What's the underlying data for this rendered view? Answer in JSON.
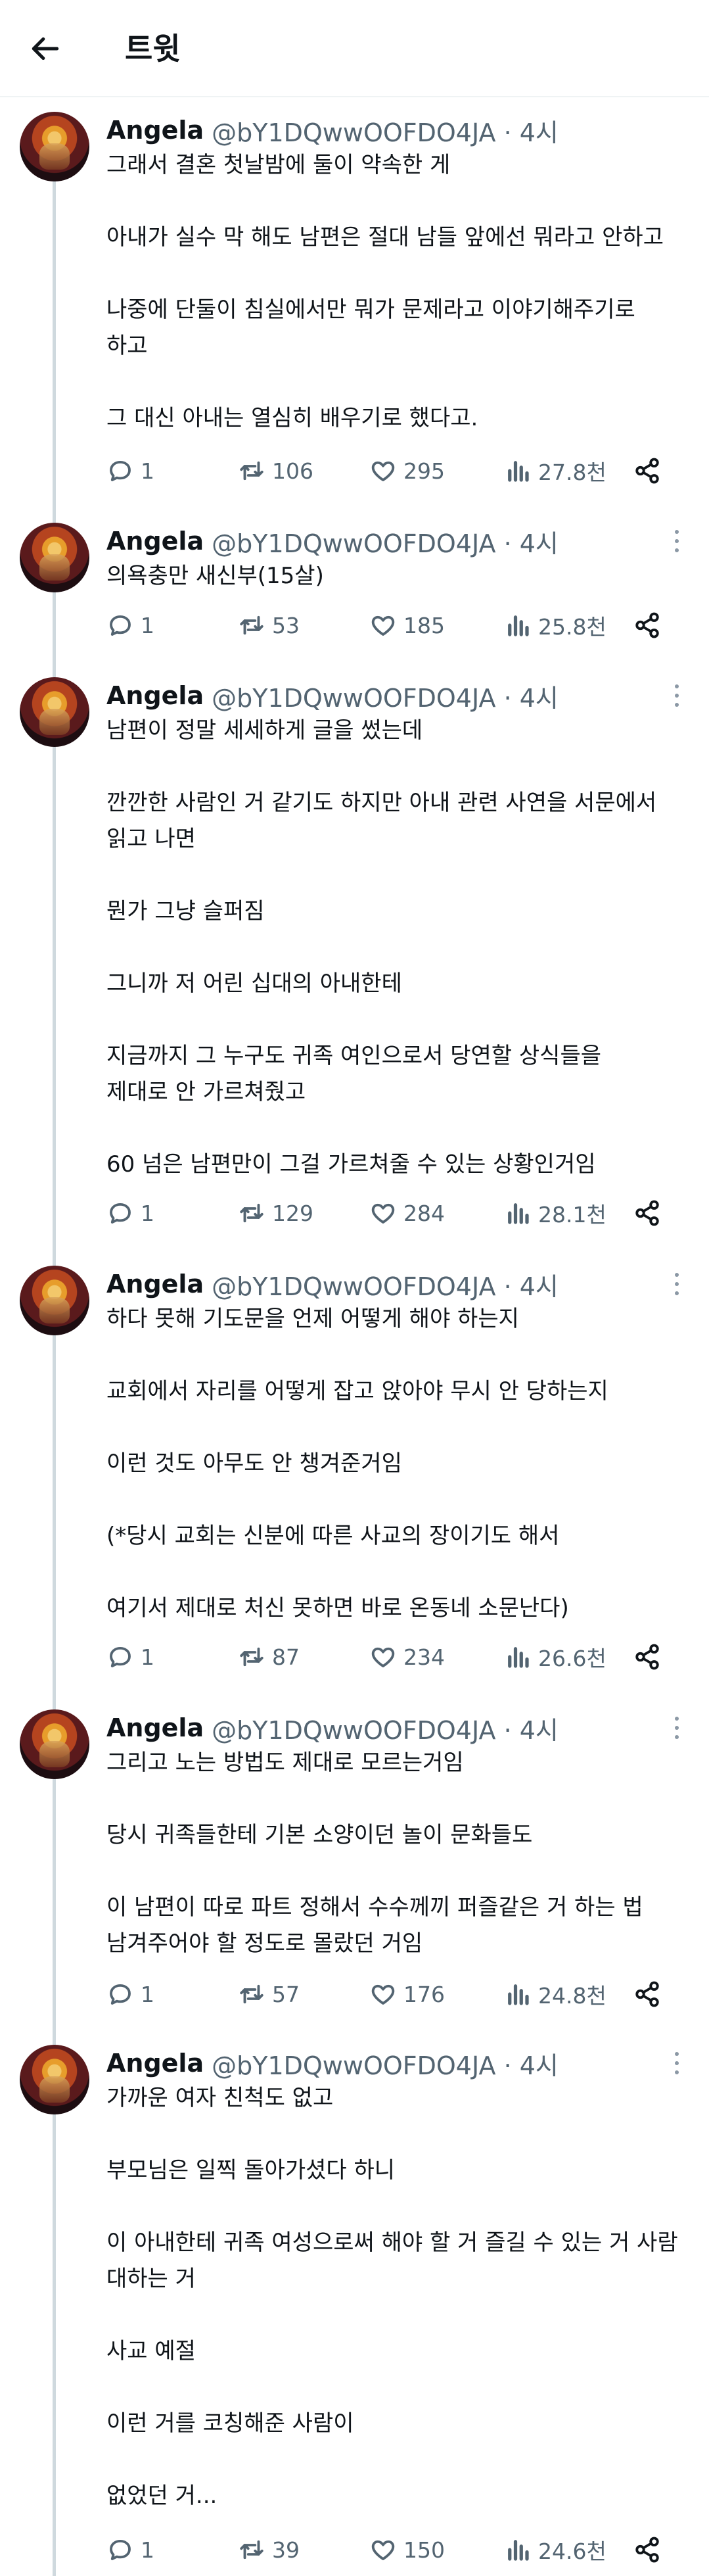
{
  "header": {
    "title": "트윗"
  },
  "tweets": [
    {
      "name": "Angela",
      "handle": "@bY1DQwwOOFDO4JA · 4시",
      "paragraphs": [
        "그래서 결혼 첫날밤에 둘이 약속한 게",
        "아내가 실수 막 해도 남편은 절대 남들 앞에선 뭐라고 안하고",
        "나중에 단둘이 침실에서만 뭐가 문제라고 이야기해주기로\n하고",
        "그 대신 아내는 열심히 배우기로 했다고."
      ],
      "replies": "1",
      "retweets": "106",
      "likes": "295",
      "views": "27.8천"
    },
    {
      "name": "Angela",
      "handle": "@bY1DQwwOOFDO4JA · 4시",
      "paragraphs": [
        "의욕충만 새신부(15살)"
      ],
      "replies": "1",
      "retweets": "53",
      "likes": "185",
      "views": "25.8천"
    },
    {
      "name": "Angela",
      "handle": "@bY1DQwwOOFDO4JA · 4시",
      "paragraphs": [
        "남편이 정말 세세하게 글을 썼는데",
        "깐깐한 사람인 거 같기도 하지만 아내 관련 사연을 서문에서\n읽고 나면",
        "뭔가 그냥 슬퍼짐",
        "그니까 저 어린 십대의 아내한테",
        "지금까지 그 누구도 귀족 여인으로서 당연할 상식들을\n제대로 안 가르쳐줬고",
        "60 넘은 남편만이 그걸 가르쳐줄 수 있는 상황인거임"
      ],
      "replies": "1",
      "retweets": "129",
      "likes": "284",
      "views": "28.1천"
    },
    {
      "name": "Angela",
      "handle": "@bY1DQwwOOFDO4JA · 4시",
      "paragraphs": [
        "하다 못해 기도문을 언제 어떻게 해야 하는지",
        "교회에서 자리를 어떻게 잡고 앉아야 무시 안 당하는지",
        "이런 것도 아무도 안 챙겨준거임",
        "(*당시 교회는 신분에 따른 사교의 장이기도 해서",
        "여기서 제대로 처신 못하면 바로 온동네 소문난다)"
      ],
      "replies": "1",
      "retweets": "87",
      "likes": "234",
      "views": "26.6천"
    },
    {
      "name": "Angela",
      "handle": "@bY1DQwwOOFDO4JA · 4시",
      "paragraphs": [
        "그리고 노는 방법도 제대로 모르는거임",
        "당시 귀족들한테 기본 소양이던 놀이 문화들도",
        "이 남편이 따로 파트 정해서 수수께끼 퍼즐같은 거 하는 법\n남겨주어야 할 정도로 몰랐던 거임"
      ],
      "replies": "1",
      "retweets": "57",
      "likes": "176",
      "views": "24.8천"
    },
    {
      "name": "Angela",
      "handle": "@bY1DQwwOOFDO4JA · 4시",
      "paragraphs": [
        "가까운 여자 친척도 없고",
        "부모님은 일찍 돌아가셨다 하니",
        "이 아내한테 귀족 여성으로써 해야 할 거 즐길 수 있는 거 사람\n대하는 거",
        "사교 예절",
        "이런 거를 코칭해준 사람이",
        "없었던 거..."
      ],
      "replies": "1",
      "retweets": "39",
      "likes": "150",
      "views": "24.6천"
    }
  ]
}
